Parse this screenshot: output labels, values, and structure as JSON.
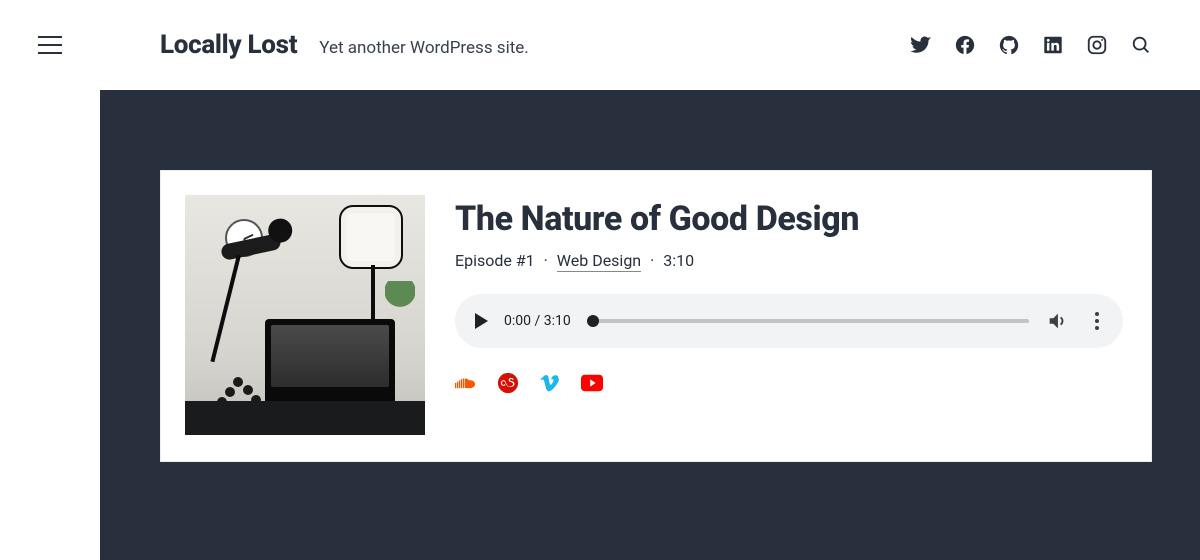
{
  "site": {
    "title": "Locally Lost",
    "tagline": "Yet another WordPress site."
  },
  "header_social": [
    {
      "name": "twitter"
    },
    {
      "name": "facebook"
    },
    {
      "name": "github"
    },
    {
      "name": "linkedin"
    },
    {
      "name": "instagram"
    }
  ],
  "episode": {
    "title": "The Nature of Good Design",
    "meta": {
      "prefix": "Episode #1",
      "category": "Web Design",
      "duration": "3:10"
    },
    "player": {
      "current": "0:00",
      "sep": " / ",
      "total": "3:10"
    },
    "share": [
      {
        "name": "soundcloud",
        "color": "#ff5500"
      },
      {
        "name": "lastfm",
        "color": "#d51007"
      },
      {
        "name": "vimeo",
        "color": "#1ab7ea"
      },
      {
        "name": "youtube",
        "color": "#ff0000"
      }
    ]
  }
}
